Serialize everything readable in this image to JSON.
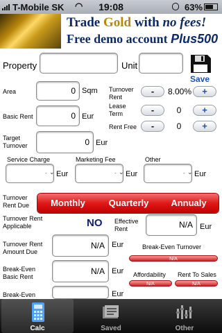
{
  "status": {
    "carrier": "T-Mobile SK",
    "time": "19:08",
    "battery": "63%"
  },
  "ad": {
    "line1_pre": "Trade ",
    "line1_gold": "Gold",
    "line1_post": " with ",
    "line1_em": "no fees!",
    "line2": "Free demo account ",
    "brand": "Plus500"
  },
  "property": {
    "label": "Property",
    "value": "",
    "unit_label": "Unit",
    "unit_value": "",
    "save": "Save"
  },
  "area": {
    "label": "Area",
    "value": "0",
    "unit": "Sqm"
  },
  "basic_rent": {
    "label": "Basic Rent",
    "value": "0",
    "unit": "Eur"
  },
  "target_turnover": {
    "label": "Target Turnover",
    "value": "0",
    "unit": "Eur"
  },
  "turnover_rent": {
    "label": "Turnover Rent",
    "value": "8.00%",
    "minus": "-",
    "plus": "+"
  },
  "lease_term": {
    "label": "Lease Term",
    "value": "0",
    "minus": "-",
    "plus": "+"
  },
  "rent_free": {
    "label": "Rent Free",
    "value": "0",
    "minus": "-",
    "plus": "+"
  },
  "service_charge": {
    "label": "Service Charge",
    "value": "-",
    "unit": "Eur"
  },
  "marketing_fee": {
    "label": "Marketing Fee",
    "value": "-",
    "unit": "Eur"
  },
  "other": {
    "label": "Other",
    "value": "-",
    "unit": "Eur"
  },
  "rent_due": {
    "label": "Turnover Rent Due",
    "options": [
      "Monthly",
      "Quarterly",
      "Annualy"
    ]
  },
  "rent_applicable": {
    "label": "Turnover Rent Applicable",
    "value": "NO"
  },
  "effective_rent": {
    "label": "Effective Rent",
    "value": "N/A",
    "unit": "Eur"
  },
  "amount_due": {
    "label": "Turnover Rent Amount Due",
    "value": "N/A",
    "unit": "Eur"
  },
  "break_even_turnover": {
    "label": "Break-Even Turnover",
    "value": "N/A"
  },
  "break_even_basic_rent": {
    "label": "Break-Even Basic Rent",
    "value": "N/A",
    "unit": "Eur"
  },
  "affordability": {
    "label": "Affordability",
    "value": "N/A"
  },
  "rent_to_sales": {
    "label": "Rent To Sales",
    "value": "N/A"
  },
  "break_even_last": {
    "label": "Break-Even",
    "unit": "Eur"
  },
  "tabs": [
    {
      "label": "Calc",
      "icon": "calculator-icon"
    },
    {
      "label": "Saved",
      "icon": "saved-icon"
    },
    {
      "label": "Other",
      "icon": "other-icon"
    }
  ]
}
